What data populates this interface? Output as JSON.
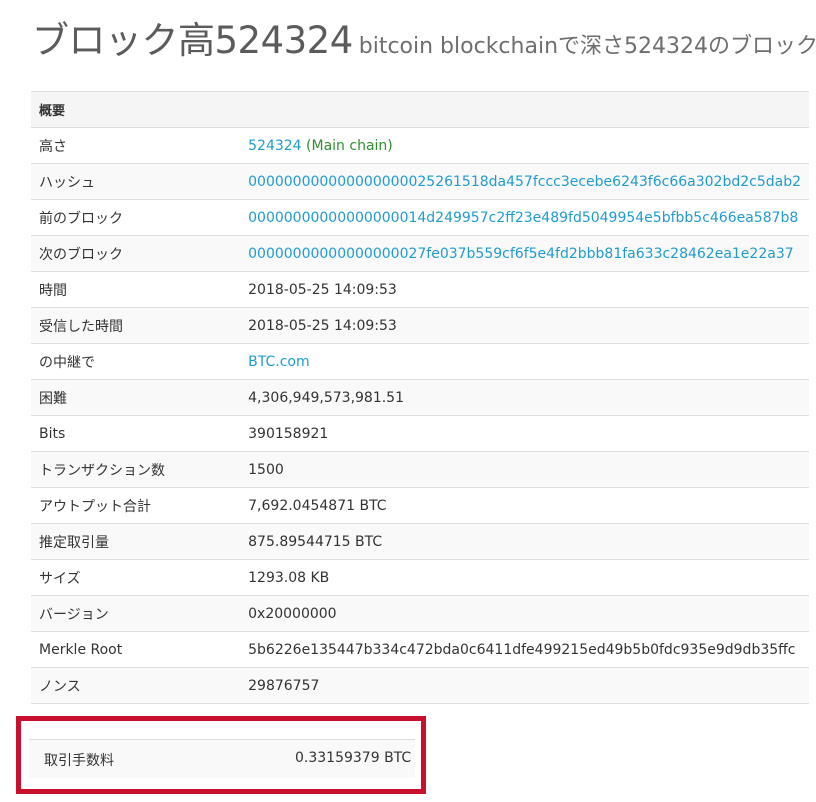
{
  "header": {
    "title": "ブロック高524324",
    "subtitle": "bitcoin blockchainで深さ524324のブロック"
  },
  "table": {
    "summary_label": "概要",
    "rows": {
      "height": {
        "label": "高さ",
        "value": "524324",
        "status": "(Main chain)"
      },
      "hash": {
        "label": "ハッシュ",
        "value": "000000000000000000025261518da457fccc3ecebe6243f6c66a302bd2c5dab2"
      },
      "prev_block": {
        "label": "前のブロック",
        "value": "00000000000000000014d249957c2ff23e489fd5049954e5bfbb5c466ea587b8"
      },
      "next_block": {
        "label": "次のブロック",
        "value": "00000000000000000027fe037b559cf6f5e4fd2bbb81fa633c28462ea1e22a37"
      },
      "time": {
        "label": "時間",
        "value": "2018-05-25 14:09:53"
      },
      "received_time": {
        "label": "受信した時間",
        "value": "2018-05-25 14:09:53"
      },
      "relayed_by": {
        "label": "の中継で",
        "value": "BTC.com"
      },
      "difficulty": {
        "label": "困難",
        "value": "4,306,949,573,981.51"
      },
      "bits": {
        "label": "Bits",
        "value": "390158921"
      },
      "tx_count": {
        "label": "トランザクション数",
        "value": "1500"
      },
      "output_total": {
        "label": "アウトプット合計",
        "value": "7,692.0454871 BTC"
      },
      "estimated_volume": {
        "label": "推定取引量",
        "value": "875.89544715 BTC"
      },
      "size": {
        "label": "サイズ",
        "value": "1293.08 KB"
      },
      "version": {
        "label": "バージョン",
        "value": "0x20000000"
      },
      "merkle_root": {
        "label": "Merkle Root",
        "value": "5b6226e135447b334c472bda0c6411dfe499215ed49b5b0fdc935e9d9db35ffc"
      },
      "nonce": {
        "label": "ノンス",
        "value": "29876757"
      },
      "fee": {
        "label": "取引手数料",
        "value": "0.33159379 BTC"
      }
    }
  },
  "colors": {
    "link": "#1f9bcf",
    "main_chain": "#2f8f2f",
    "highlight_border": "#c8102e"
  }
}
